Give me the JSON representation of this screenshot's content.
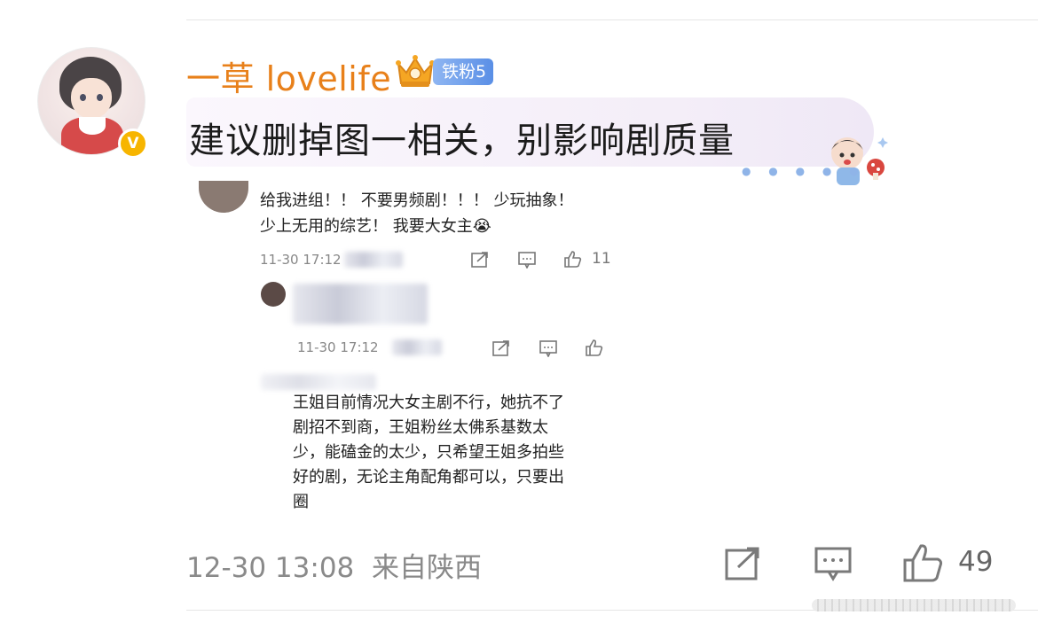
{
  "comment": {
    "username": "一草 lovelife",
    "fan_badge": "铁粉5",
    "verified_badge": "V",
    "text": "建议删掉图一相关，别影响剧质量",
    "timestamp": "12-30 13:08",
    "location": "来自陕西",
    "like_count": "49"
  },
  "embedded": {
    "reply1": {
      "line1": "给我进组！！ 不要男频剧！！！ 少玩抽象！",
      "line2": "少上无用的综艺！ 我要大女主😭",
      "time": "11-30 17:12",
      "likes": "11"
    },
    "reply2": {
      "time": "11-30 17:12"
    },
    "reply3": {
      "lines": [
        "王姐目前情况大女主剧不行，她抗不了",
        "剧招不到商，王姐粉丝太佛系基数太",
        "少，能磕金的太少，只希望王姐多拍些",
        "好的剧，无论主角配角都可以，只要出",
        "圈"
      ]
    }
  },
  "colors": {
    "username": "#e8801a",
    "fan_badge": "#5a8fe6",
    "verified": "#f7b500",
    "meta": "#8a8a8a"
  }
}
